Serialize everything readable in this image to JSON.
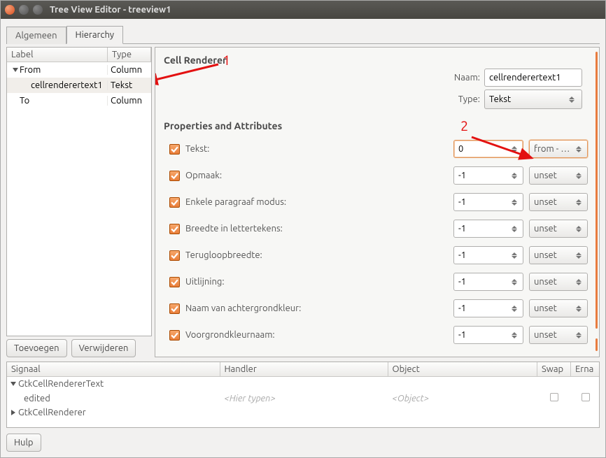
{
  "title": "Tree View Editor - treeview1",
  "tabs": {
    "general": "Algemeen",
    "hierarchy": "Hierarchy"
  },
  "tree": {
    "headers": {
      "label": "Label",
      "type": "Type"
    },
    "rows": [
      {
        "label": "From",
        "type": "Column",
        "depth": 0,
        "expanded": true
      },
      {
        "label": "cellrenderertext1",
        "type": "Tekst",
        "depth": 1,
        "expanded": null,
        "selected": true
      },
      {
        "label": "To",
        "type": "Column",
        "depth": 0,
        "expanded": null
      }
    ]
  },
  "leftButtons": {
    "add": "Toevoegen",
    "remove": "Verwijderen"
  },
  "right": {
    "title1": "Cell Renderer",
    "nameLabel": "Naam:",
    "nameValue": "cellrenderertext1",
    "typeLabel": "Type:",
    "typeValue": "Tekst",
    "title2": "Properties and Attributes",
    "props": [
      {
        "label": "Tekst:",
        "spin": "0",
        "attr": "from - …",
        "active": true
      },
      {
        "label": "Opmaak:",
        "spin": "-1",
        "attr": "unset"
      },
      {
        "label": "Enkele paragraaf modus:",
        "spin": "-1",
        "attr": "unset"
      },
      {
        "label": "Breedte in lettertekens:",
        "spin": "-1",
        "attr": "unset"
      },
      {
        "label": "Terugloopbreedte:",
        "spin": "-1",
        "attr": "unset"
      },
      {
        "label": "Uitlijning:",
        "spin": "-1",
        "attr": "unset"
      },
      {
        "label": "Naam van achtergrondkleur:",
        "spin": "-1",
        "attr": "unset"
      },
      {
        "label": "Voorgrondkleurnaam:",
        "spin": "-1",
        "attr": "unset"
      }
    ]
  },
  "signals": {
    "headers": {
      "signal": "Signaal",
      "handler": "Handler",
      "object": "Object",
      "swap": "Swap",
      "after": "Erna"
    },
    "rows": [
      {
        "name": "GtkCellRendererText",
        "depth": 0,
        "expanded": true
      },
      {
        "name": "edited",
        "depth": 1,
        "handler_ph": "<Hier typen>",
        "object_ph": "<Object>",
        "checks": true
      },
      {
        "name": "GtkCellRenderer",
        "depth": 0,
        "expanded": false
      }
    ]
  },
  "help": "Hulp",
  "annotations": {
    "one": "1",
    "two": "2"
  }
}
